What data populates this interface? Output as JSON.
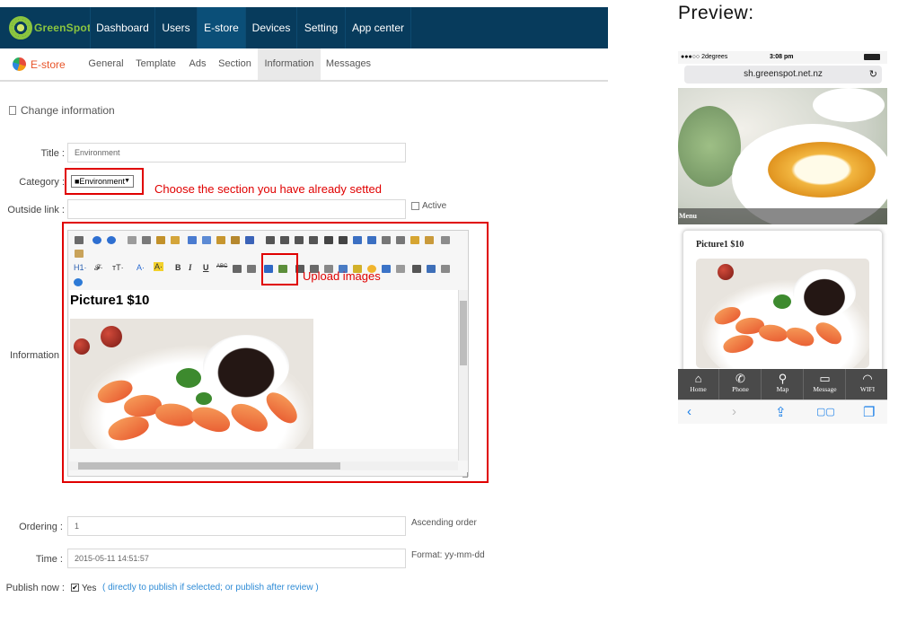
{
  "nav": {
    "logo_text": "GreenSpot",
    "items": [
      {
        "label": "Dashboard"
      },
      {
        "label": "Users"
      },
      {
        "label": "E-store",
        "active": true
      },
      {
        "label": "Devices"
      },
      {
        "label": "Setting"
      },
      {
        "label": "App center"
      }
    ]
  },
  "subnav": {
    "section_label": "E-store",
    "items": [
      {
        "label": "General"
      },
      {
        "label": "Template"
      },
      {
        "label": "Ads"
      },
      {
        "label": "Section"
      },
      {
        "label": "Information",
        "active": true
      },
      {
        "label": "Messages"
      }
    ]
  },
  "form": {
    "heading": "Change information",
    "title_label": "Title :",
    "title_value": "Environment",
    "category_label": "Category :",
    "category_value": "■Environment",
    "category_callout": "Choose the section you have already setted",
    "outside_link_label": "Outside link :",
    "outside_link_value": "",
    "active_label": "Active",
    "information_label": "Information",
    "upload_callout": "Upload images",
    "editor_heading": "Picture1  $10",
    "ordering_label": "Ordering :",
    "ordering_value": "1",
    "ordering_hint": "Ascending order",
    "time_label": "Time :",
    "time_value": "2015-05-11 14:51:57",
    "time_hint": "Format: yy-mm-dd",
    "publish_label": "Publish now :",
    "publish_yes": "Yes",
    "publish_checked": true,
    "publish_note": "( directly to publish if selected; or publish after review )"
  },
  "toolbar_row1": [
    "doc",
    "undo",
    "redo",
    "sep",
    "preview",
    "print",
    "template",
    "source",
    "sep",
    "cut",
    "copy",
    "paste",
    "paste-text",
    "paste-word",
    "sep",
    "align-left",
    "align-center",
    "align-right",
    "justify",
    "ordered-list",
    "unordered-list",
    "indent",
    "outdent",
    "subscript",
    "superscript",
    "clear",
    "format-painter",
    "select-all",
    "fullscreen"
  ],
  "toolbar_row2_labels": {
    "h1": "H1·",
    "font": "𝓕·",
    "size": "тT·",
    "fontcolor": "A·",
    "bgcolor": "A·",
    "bold": "B",
    "italic": "I",
    "underline": "U",
    "strike": "ABC"
  },
  "preview": {
    "title": "Preview:",
    "carrier": "●●●○○ 2degrees",
    "time": "3:08 pm",
    "url": "sh.greenspot.net.nz",
    "menu_label": "Menu",
    "card_title": "Picture1  $10",
    "tabs": [
      {
        "label": "Home",
        "icon": "home-icon",
        "glyph": "⌂"
      },
      {
        "label": "Phone",
        "icon": "phone-icon",
        "glyph": "✆"
      },
      {
        "label": "Map",
        "icon": "map-pin-icon",
        "glyph": "⚲"
      },
      {
        "label": "Message",
        "icon": "message-icon",
        "glyph": "▭"
      },
      {
        "label": "WIFI",
        "icon": "wifi-icon",
        "glyph": "◠"
      }
    ],
    "safari": [
      "‹",
      "›",
      "⇪",
      "▢▢",
      "❐"
    ]
  },
  "colors": {
    "nav_bg": "#073b5c",
    "nav_active": "#0b4f78",
    "brand_green": "#8bc53f",
    "estore_orange": "#e8552a",
    "callout_red": "#e00000",
    "link_blue": "#2e8bd6"
  }
}
